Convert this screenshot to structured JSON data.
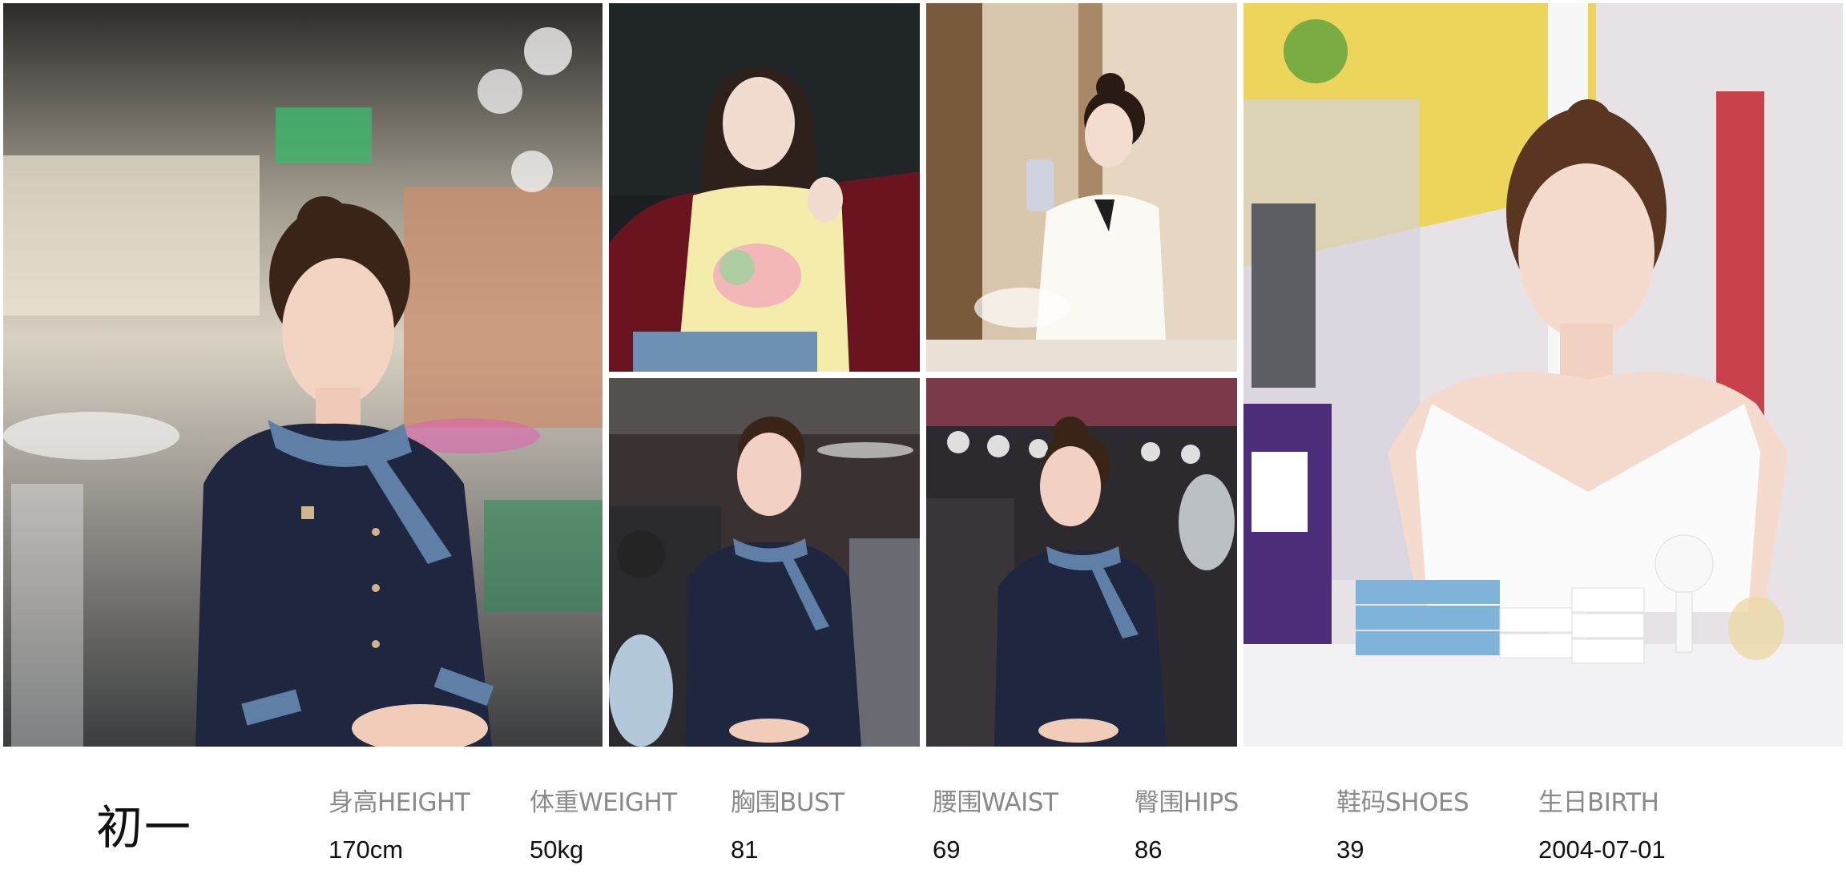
{
  "profile": {
    "name": "初一",
    "stats": [
      {
        "label": "身高HEIGHT",
        "value": "170cm"
      },
      {
        "label": "体重WEIGHT",
        "value": "50kg"
      },
      {
        "label": "胸围BUST",
        "value": "81"
      },
      {
        "label": "腰围WAIST",
        "value": "69"
      },
      {
        "label": "臀围HIPS",
        "value": "86"
      },
      {
        "label": "鞋码SHOES",
        "value": "39"
      },
      {
        "label": "生日BIRTH",
        "value": "2004-07-01"
      }
    ]
  },
  "colors": {
    "background": "#ffffff",
    "label_gray": "#8a8a8a",
    "value_black": "#111111",
    "uniform_navy": "#1f2740",
    "scarf_blue": "#5f7fa6"
  },
  "icons": {
    "photos": "photo-icon"
  }
}
